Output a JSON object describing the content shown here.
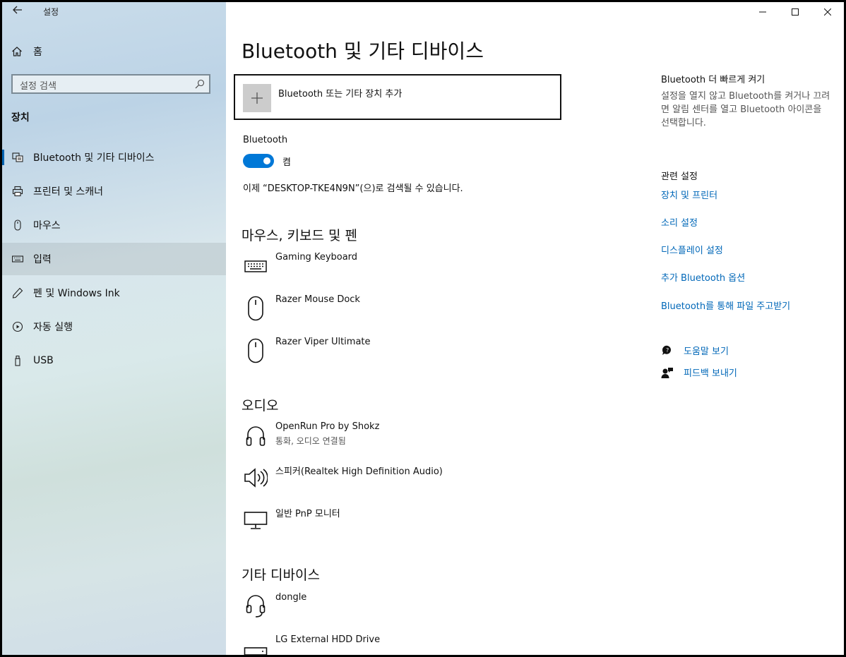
{
  "window": {
    "title": "설정"
  },
  "sidebar": {
    "home_label": "홈",
    "search_placeholder": "설정 검색",
    "section_title": "장치",
    "items": [
      {
        "label": "Bluetooth 및 기타 디바이스",
        "icon": "bluetooth-devices-icon"
      },
      {
        "label": "프린터 및 스캐너",
        "icon": "printer-icon"
      },
      {
        "label": "마우스",
        "icon": "mouse-icon"
      },
      {
        "label": "입력",
        "icon": "keyboard-icon"
      },
      {
        "label": "펜 및 Windows Ink",
        "icon": "pen-icon"
      },
      {
        "label": "자동 실행",
        "icon": "autoplay-icon"
      },
      {
        "label": "USB",
        "icon": "usb-icon"
      }
    ]
  },
  "main": {
    "title": "Bluetooth 및 기타 디바이스",
    "add_device_label": "Bluetooth 또는 기타 장치 추가",
    "bluetooth_label": "Bluetooth",
    "bluetooth_state": "켬",
    "discoverable_text": "이제 “DESKTOP-TKE4N9N”(으)로 검색될 수 있습니다.",
    "groups": [
      {
        "title": "마우스, 키보드 및 펜",
        "devices": [
          {
            "name": "Gaming Keyboard",
            "icon": "keyboard-icon"
          },
          {
            "name": "Razer Mouse Dock",
            "icon": "mouse-icon"
          },
          {
            "name": "Razer Viper Ultimate",
            "icon": "mouse-icon"
          }
        ]
      },
      {
        "title": "오디오",
        "devices": [
          {
            "name": "OpenRun Pro by Shokz",
            "sub": "통화, 오디오 연결됨",
            "icon": "headphones-icon"
          },
          {
            "name": "스피커(Realtek High Definition Audio)",
            "icon": "speaker-icon"
          },
          {
            "name": "일반 PnP 모니터",
            "icon": "monitor-icon"
          }
        ]
      },
      {
        "title": "기타 디바이스",
        "devices": [
          {
            "name": "dongle",
            "icon": "headset-icon"
          },
          {
            "name": "LG External HDD Drive",
            "icon": "drive-icon"
          }
        ]
      }
    ]
  },
  "right": {
    "quick_title": "Bluetooth 더 빠르게 켜기",
    "quick_text": "설정을 열지 않고 Bluetooth를 켜거나 끄려면 알림 센터를 열고 Bluetooth 아이콘을 선택합니다.",
    "related_title": "관련 설정",
    "links": [
      "장치 및 프린터",
      "소리 설정",
      "디스플레이 설정",
      "추가 Bluetooth 옵션",
      "Bluetooth를 통해 파일 주고받기"
    ],
    "help_label": "도움말 보기",
    "feedback_label": "피드백 보내기"
  }
}
